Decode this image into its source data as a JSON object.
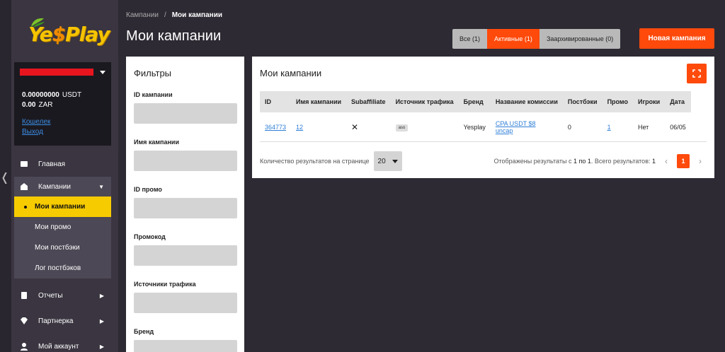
{
  "brand": {
    "logo_text_a": "Ye",
    "logo_text_s": "$",
    "logo_text_b": "Play",
    "accent": "#ff4a0b",
    "yellow": "#f6cb00"
  },
  "account": {
    "balances": [
      {
        "amount": "0.00000000",
        "currency": "USDT"
      },
      {
        "amount": "0.00",
        "currency": "ZAR"
      }
    ],
    "wallet_link": "Кошелек",
    "logout_link": "Выход"
  },
  "sidebar": {
    "home": "Главная",
    "campaigns": "Кампании",
    "sub": [
      "Мои кампании",
      "Мои промо",
      "Мои постбэки",
      "Лог постбэков"
    ],
    "reports": "Отчеты",
    "partner": "Партнерка",
    "my_account": "Мой аккаунт"
  },
  "breadcrumb": {
    "parent": "Кампании",
    "separator": "/",
    "current": "Мои кампании"
  },
  "page_title": "Мои кампании",
  "tabs": {
    "all": "Все (1)",
    "active": "Активные (1)",
    "archived": "Заархивированные (0)"
  },
  "new_campaign_button": "Новая кампания",
  "filters": {
    "title": "Фильтры",
    "fields": [
      "ID кампании",
      "Имя кампании",
      "ID промо",
      "Промокод",
      "Источники трафика",
      "Бренд"
    ]
  },
  "table": {
    "title": "Мои кампании",
    "columns": [
      "ID",
      "Имя кампании",
      "Subaffiliate",
      "Источник трафика",
      "Бренд",
      "Название комиссии",
      "Постбэки",
      "Промо",
      "Игроки",
      "Дата"
    ],
    "rows": [
      {
        "id": "364773",
        "name": "12",
        "subaffiliate": "✕",
        "traffic_source": "aso",
        "brand": "Yesplay",
        "commission_line1": "CPA USDT $8",
        "commission_line2": "uncap",
        "postbacks": "0",
        "promo": "1",
        "players": "Нет",
        "date": "06/05"
      }
    ]
  },
  "pagination": {
    "per_page_label": "Количество результатов на странице",
    "per_page_value": "20",
    "info_prefix": "Отображены результаты с ",
    "info_range": "1 по 1",
    "info_total_prefix": ". Всего результатов: ",
    "info_total": "1",
    "current_page": "1"
  }
}
